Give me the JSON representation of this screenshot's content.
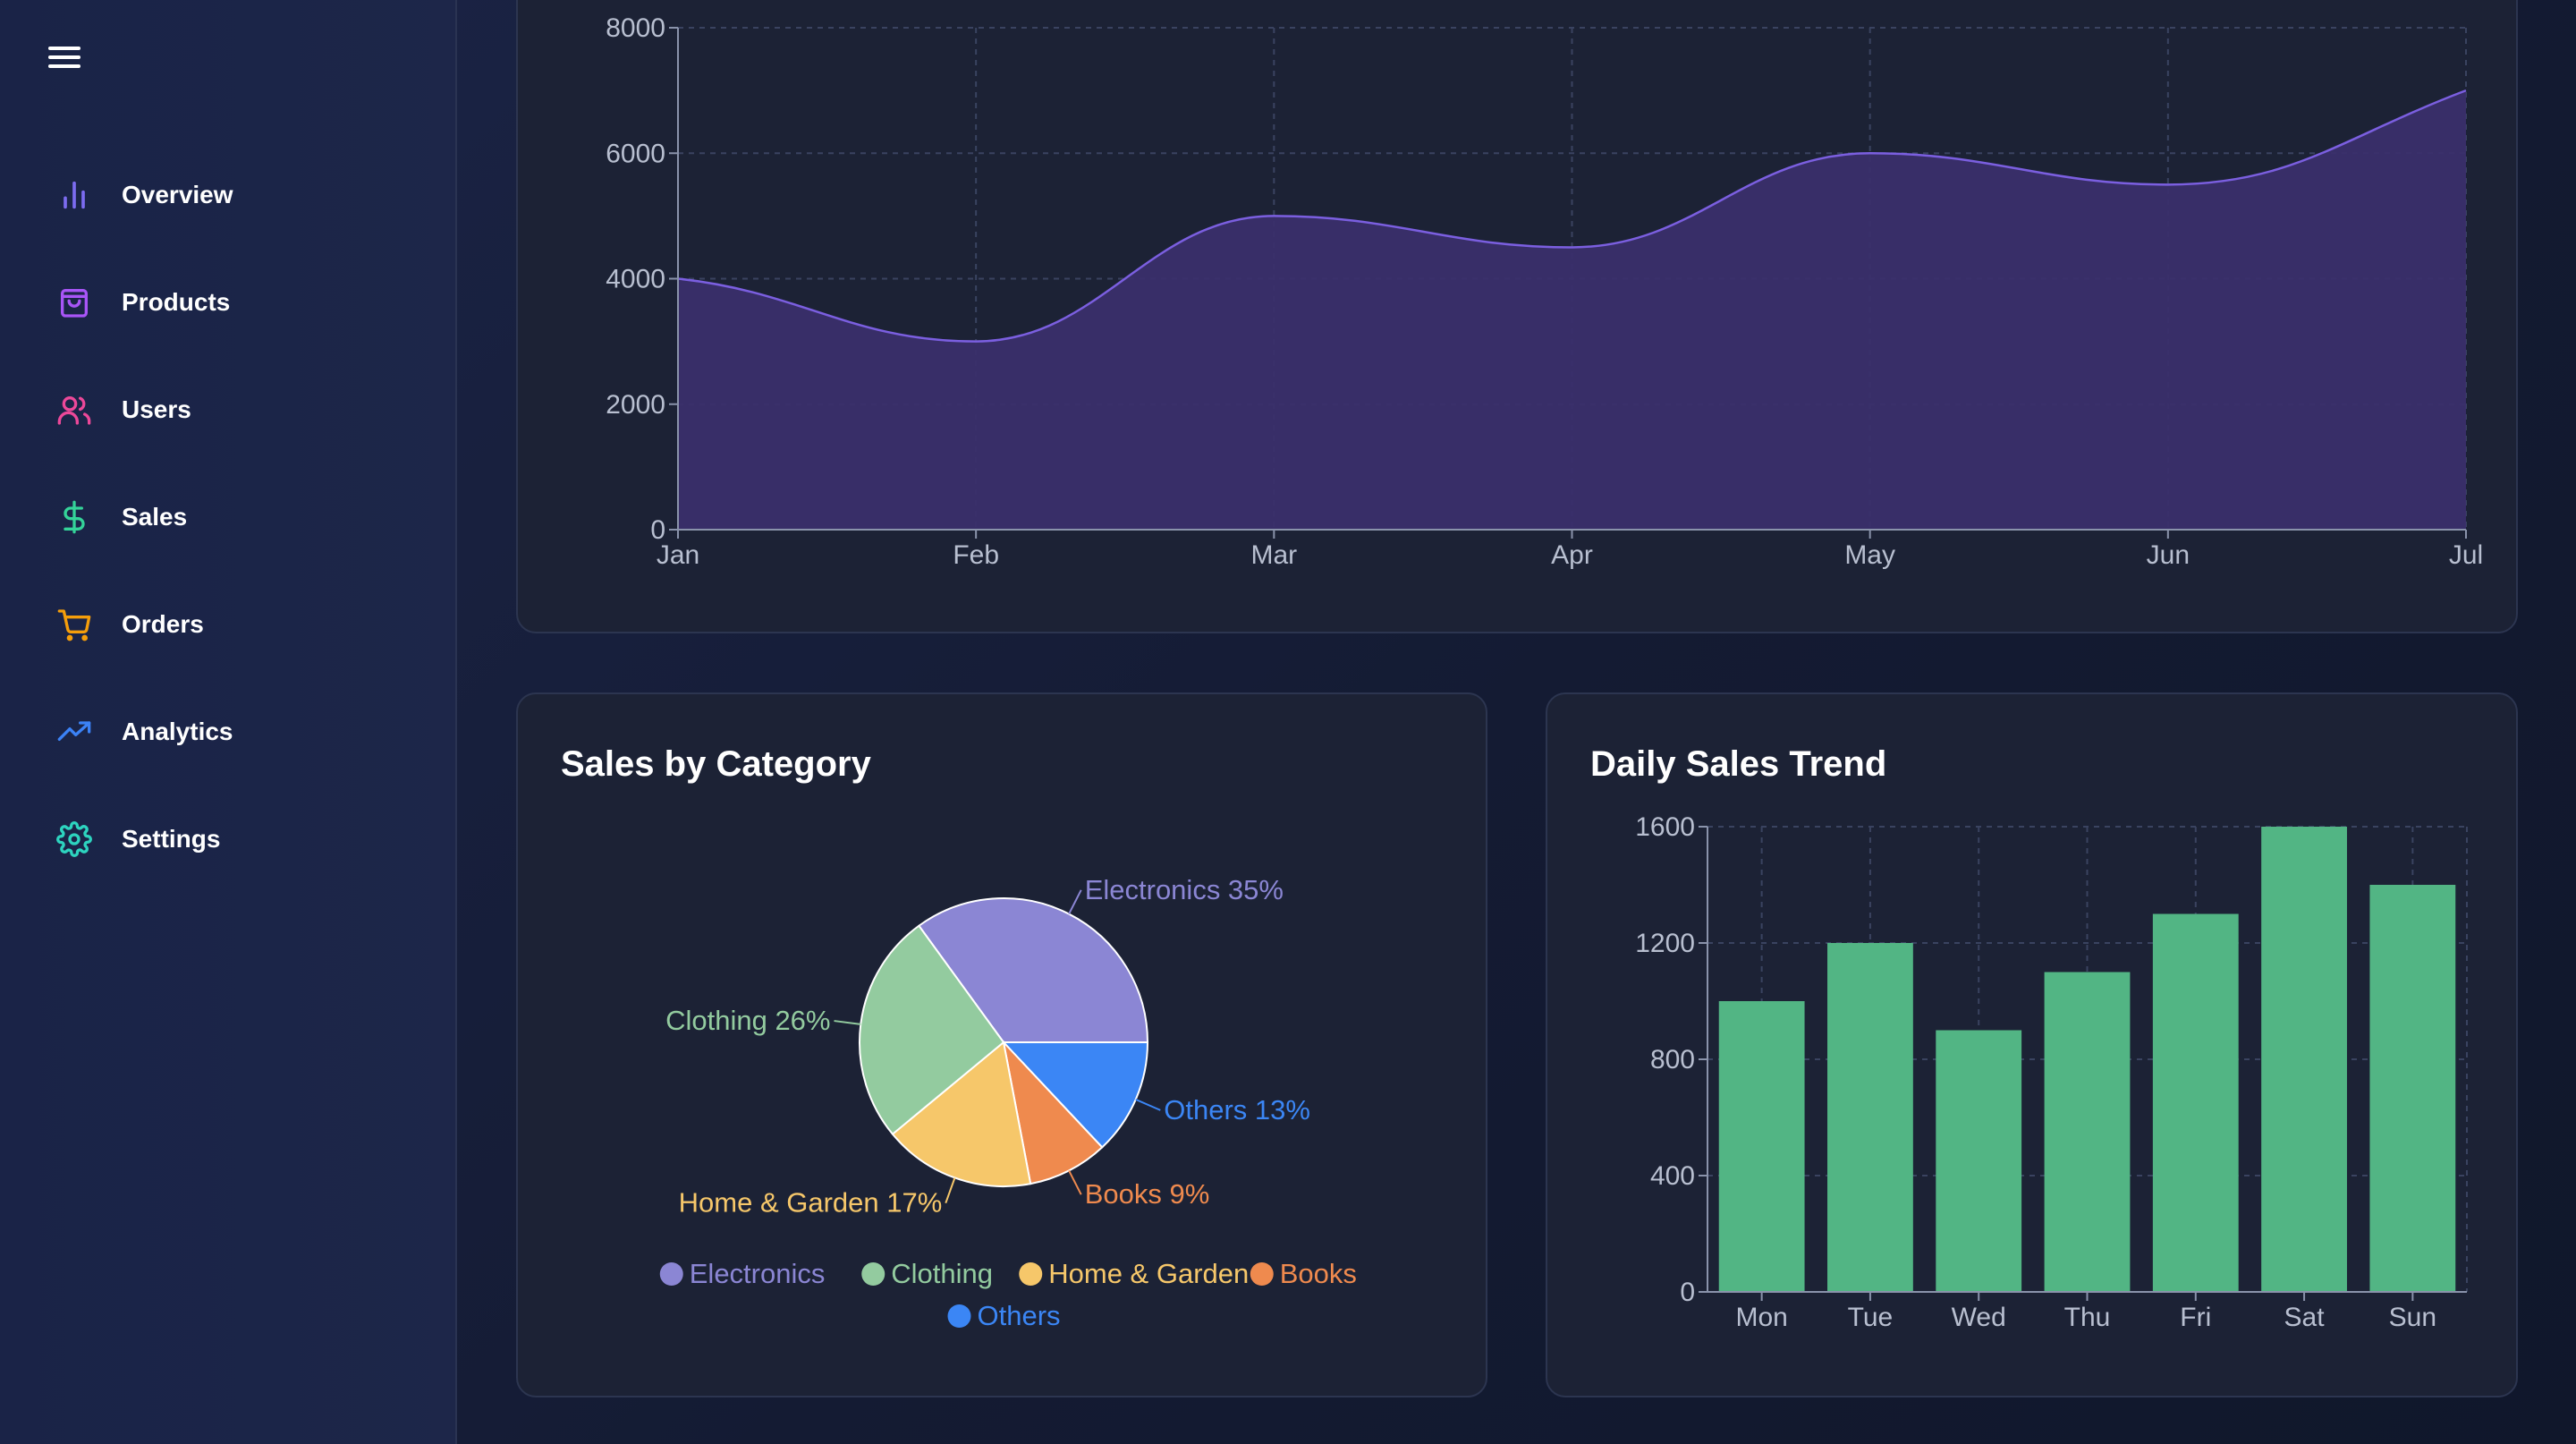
{
  "sidebar": {
    "menu_icon": "hamburger-menu-icon",
    "items": [
      {
        "label": "Overview",
        "icon": "bar-chart-icon",
        "color": "#7c6cf0"
      },
      {
        "label": "Products",
        "icon": "shopping-bag-icon",
        "color": "#a855f7"
      },
      {
        "label": "Users",
        "icon": "users-icon",
        "color": "#ec4899"
      },
      {
        "label": "Sales",
        "icon": "dollar-icon",
        "color": "#34d399"
      },
      {
        "label": "Orders",
        "icon": "cart-icon",
        "color": "#f59e0b"
      },
      {
        "label": "Analytics",
        "icon": "trending-up-icon",
        "color": "#3b82f6"
      },
      {
        "label": "Settings",
        "icon": "gear-icon",
        "color": "#2dd4bf"
      }
    ]
  },
  "colors": {
    "area_fill": "#3a2f6b",
    "area_stroke": "#7b5fe0",
    "bar_fill": "#52b584",
    "electronics": "#8b86d4",
    "clothing": "#93cb9f",
    "home_garden": "#f6c76a",
    "books": "#ef8a4e",
    "others": "#3b86f5"
  },
  "charts": {
    "pie_title": "Sales by Category",
    "bar_title": "Daily Sales Trend"
  },
  "chart_data": [
    {
      "type": "area",
      "x": [
        "Jan",
        "Feb",
        "Mar",
        "Apr",
        "May",
        "Jun",
        "Jul"
      ],
      "values": [
        4000,
        3000,
        5000,
        4500,
        6000,
        5500,
        7000
      ],
      "ylim": [
        0,
        8000
      ],
      "yticks": [
        "0",
        "2000",
        "4000",
        "6000",
        "8000"
      ],
      "grid": true
    },
    {
      "type": "pie",
      "title": "Sales by Category",
      "slices": [
        {
          "name": "Electronics",
          "value": 35,
          "label": "Electronics 35%"
        },
        {
          "name": "Others",
          "value": 13,
          "label": "Others 13%"
        },
        {
          "name": "Books",
          "value": 9,
          "label": "Books 9%"
        },
        {
          "name": "Home & Garden",
          "value": 17,
          "label": "Home & Garden 17%"
        },
        {
          "name": "Clothing",
          "value": 26,
          "label": "Clothing 26%"
        }
      ],
      "legend": [
        "Electronics",
        "Clothing",
        "Home & Garden",
        "Books",
        "Others"
      ],
      "legend_placement": "bottom"
    },
    {
      "type": "bar",
      "title": "Daily Sales Trend",
      "categories": [
        "Mon",
        "Tue",
        "Wed",
        "Thu",
        "Fri",
        "Sat",
        "Sun"
      ],
      "values": [
        1000,
        1200,
        900,
        1100,
        1300,
        1600,
        1400
      ],
      "ylim": [
        0,
        1600
      ],
      "yticks": [
        "0",
        "400",
        "800",
        "1200",
        "1600"
      ],
      "grid": true
    }
  ]
}
